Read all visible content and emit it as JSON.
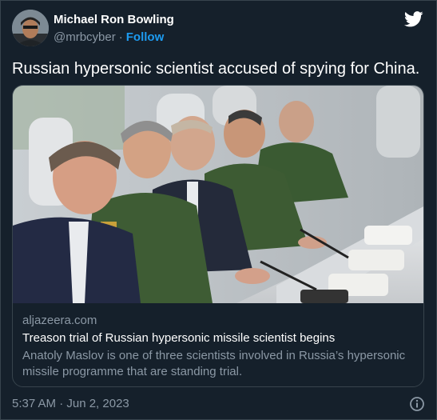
{
  "author": {
    "display_name": "Michael Ron Bowling",
    "handle": "@mrbcyber",
    "separator": "·",
    "follow_label": "Follow"
  },
  "tweet": {
    "text": "Russian hypersonic scientist accused of spying for China."
  },
  "link_card": {
    "domain": "aljazeera.com",
    "title": "Treason trial of Russian hypersonic missile scientist begins",
    "description": "Anatoly Maslov is one of three scientists involved in Russia’s hypersonic missile programme that are standing trial."
  },
  "footer": {
    "timestamp": "5:37 AM · Jun 2, 2023"
  },
  "icons": {
    "platform": "twitter-bird-icon",
    "info": "info-icon"
  },
  "colors": {
    "background": "#15202b",
    "accent": "#1d9bf0",
    "secondary_text": "#8b98a5",
    "border": "#38444d"
  }
}
